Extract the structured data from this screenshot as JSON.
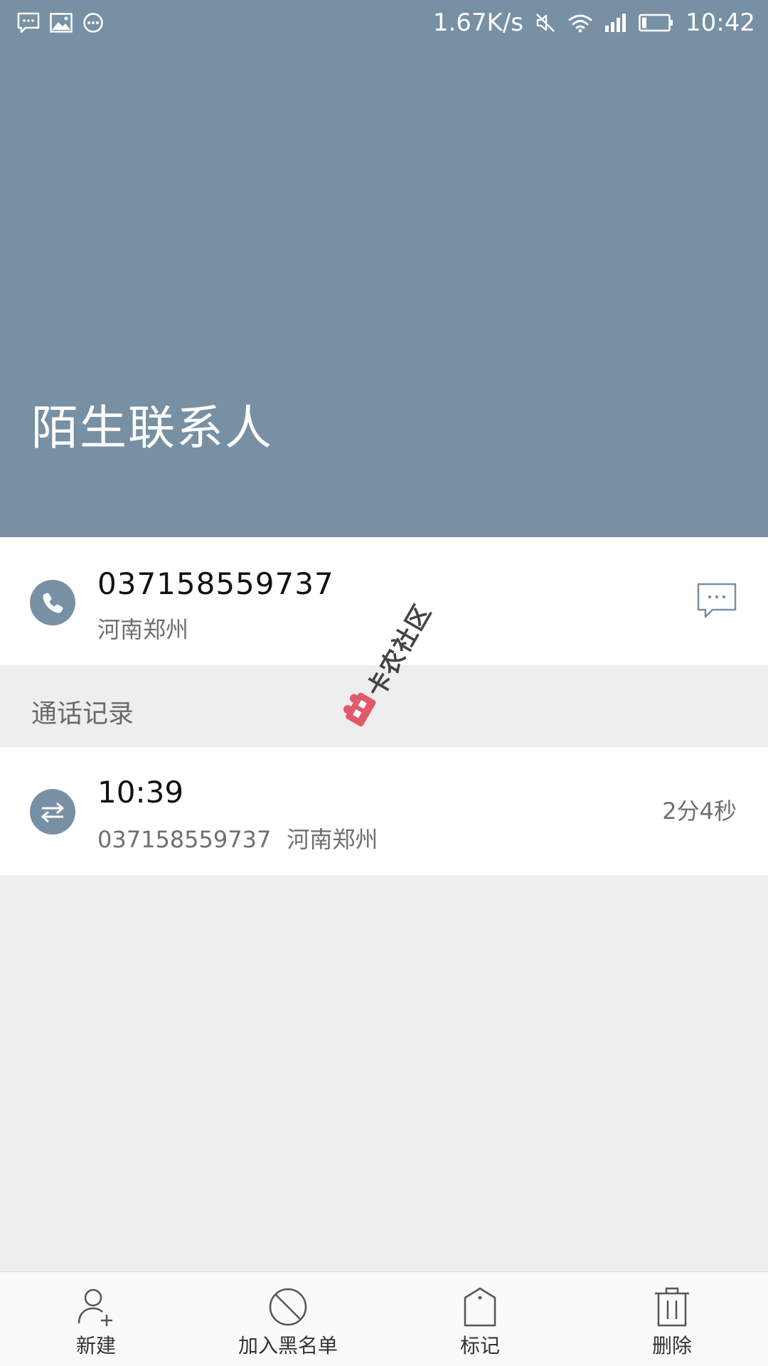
{
  "status_bar": {
    "left_icons": [
      "message-notification-icon",
      "image-notification-icon",
      "more-notification-icon"
    ],
    "network_speed": "1.67K/s",
    "right_icons": [
      "mute-icon",
      "wifi-icon",
      "signal-icon",
      "battery-icon"
    ],
    "time": "10:42"
  },
  "header": {
    "title": "陌生联系人",
    "background_color": "#7890a4"
  },
  "contact": {
    "icon": "phone-icon",
    "number": "037158559737",
    "location": "河南郑州",
    "message_icon": "message-icon"
  },
  "call_log": {
    "section_title": "通话记录",
    "entries": [
      {
        "icon": "call-transfer-icon",
        "time": "10:39",
        "number": "037158559737",
        "location": "河南郑州",
        "duration": "2分4秒"
      }
    ]
  },
  "watermark": {
    "text": "卡农社区"
  },
  "bottom_actions": [
    {
      "label": "新建",
      "icon": "add-contact-icon"
    },
    {
      "label": "加入黑名单",
      "icon": "block-icon"
    },
    {
      "label": "标记",
      "icon": "tag-icon"
    },
    {
      "label": "删除",
      "icon": "trash-icon"
    }
  ],
  "colors": {
    "accent": "#7890a4",
    "background": "#eeeeee",
    "card": "#ffffff"
  }
}
